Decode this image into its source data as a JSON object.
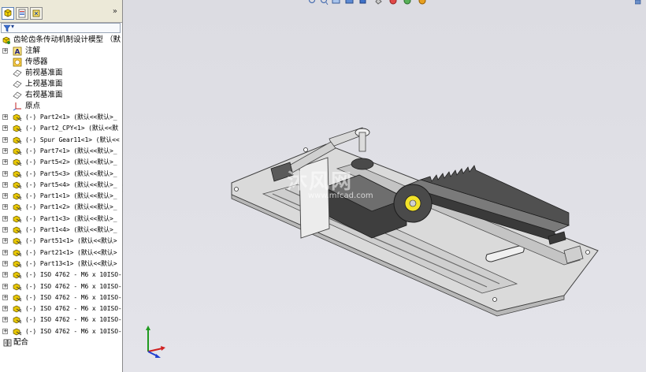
{
  "app": {
    "name": "SolidWorks"
  },
  "panel": {
    "tabs": [
      {
        "name": "feature-manager",
        "icon": "feature-tree-icon",
        "active": true
      },
      {
        "name": "property-manager",
        "icon": "property-sheet-icon",
        "active": false
      },
      {
        "name": "configuration-manager",
        "icon": "configuration-icon",
        "active": false
      }
    ],
    "overflow_label": "»",
    "filter_dropdown": "▾"
  },
  "tree": {
    "root": "齿轮齿条传动机制设计模型 （默",
    "folders": [
      {
        "icon": "annotations-icon",
        "label": "注解"
      },
      {
        "icon": "sensors-icon",
        "label": "传感器"
      },
      {
        "icon": "plane-icon",
        "label": "前视基准面"
      },
      {
        "icon": "plane-icon",
        "label": "上视基准面"
      },
      {
        "icon": "plane-icon",
        "label": "右视基准面"
      },
      {
        "icon": "origin-icon",
        "label": "原点"
      }
    ],
    "components": [
      "(-) Part2<1> (默认<<默认>_",
      "(-) Part2_CPY<1> (默认<<默",
      "(-) Spur Gear11<1> (默认<<",
      "(-) Part7<1> (默认<<默认>_",
      "(-) Part5<2> (默认<<默认>_",
      "(-) Part5<3> (默认<<默认>_",
      "(-) Part5<4> (默认<<默认>_",
      "(-) Part1<1> (默认<<默认>_",
      "(-) Part1<2> (默认<<默认>_",
      "(-) Part1<3> (默认<<默认>_",
      "(-) Part1<4> (默认<<默认>_",
      "(-) Part51<1> (默认<<默认>",
      "(-) Part21<1> (默认<<默认>",
      "(-) Part13<1> (默认<<默认>",
      "(-) ISO 4762 - M6 x 10ISO-",
      "(-) ISO 4762 - M6 x 10ISO-",
      "(-) ISO 4762 - M6 x 10ISO-",
      "(-) ISO 4762 - M6 x 10ISO-",
      "(-) ISO 4762 - M6 x 10ISO-",
      "(-) ISO 4762 - M6 x 10ISO-"
    ],
    "mates": "配合"
  },
  "viewport": {
    "watermark_text": "沐风网",
    "watermark_url": "www.mfcad.com",
    "triad_axes": [
      "x-axis",
      "y-axis",
      "z-axis"
    ]
  },
  "heads_up_toolbar": [
    "zoom-to-fit-icon",
    "zoom-area-icon",
    "previous-view-icon",
    "section-view-icon",
    "view-orientation-icon",
    "display-style-icon",
    "hide-show-icon",
    "edit-appearance-icon",
    "apply-scene-icon",
    "view-settings-icon"
  ],
  "colors": {
    "panel_bg": "#ffffff",
    "viewport_bg": "#e0e0e6",
    "part_gray": "#c9c9c9",
    "part_dark": "#3c3c3c",
    "gear_yellow": "#f2e22a",
    "component_icon_yellow": "#e8c700"
  }
}
